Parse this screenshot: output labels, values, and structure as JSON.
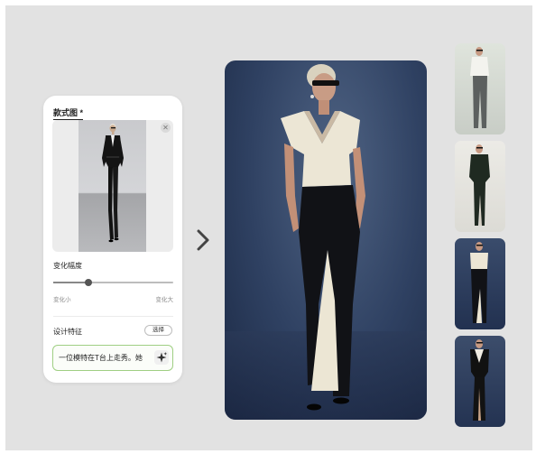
{
  "panel": {
    "title": "款式图 *",
    "close_icon": "close-icon",
    "variation_label": "变化幅度",
    "variation_level": 0.29,
    "slider_min_label": "变化小",
    "slider_max_label": "变化大",
    "design_features_label": "设计特征",
    "select_button_label": "选择",
    "prompt_value": "一位模特在T台上走秀。她",
    "sparkle_icon": "sparkle-icon"
  },
  "navigation": {
    "arrow_icon": "chevron-right-icon"
  },
  "results": {
    "main_image": "model-white-top-black-trousers",
    "thumbnails": [
      "model-white-shirt-grey-trousers",
      "model-dark-green-suit",
      "model-white-top-black-trousers",
      "model-black-gown-white-lapel"
    ]
  },
  "colors": {
    "canvas_bg": "#e2e2e2",
    "prompt_border": "#9fcf83",
    "main_bg": "#2f4162"
  }
}
